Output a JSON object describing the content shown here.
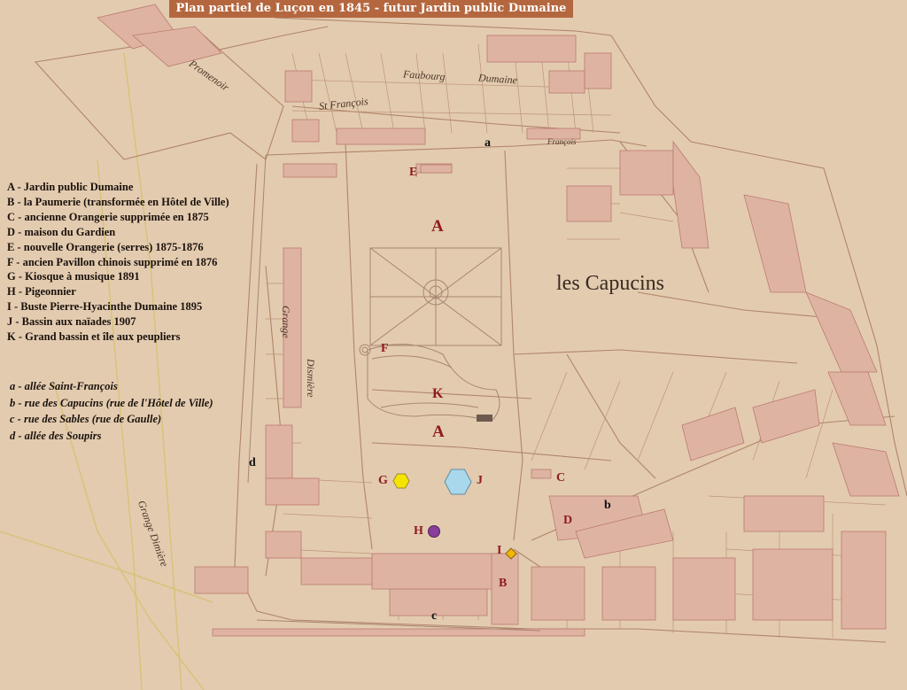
{
  "title": "Plan partiel de Luçon en 1845 - futur Jardin public Dumaine",
  "legend_uppercase": [
    "A - Jardin public Dumaine",
    "B - la Paumerie (transformée en Hôtel de Ville)",
    "C - ancienne Orangerie supprimée en 1875",
    "D - maison du Gardien",
    "E - nouvelle Orangerie (serres) 1875-1876",
    "F - ancien Pavillon chinois supprimé en 1876",
    "G - Kiosque à musique 1891",
    "H - Pigeonnier",
    "I - Buste Pierre-Hyacinthe Dumaine 1895",
    "J  - Bassin aux naïades 1907",
    "K - Grand bassin et île aux peupliers"
  ],
  "legend_lowercase": [
    "a - allée Saint-François",
    "b - rue des Capucins (rue de l'Hôtel de Ville)",
    "c - rue des Sables (rue de Gaulle)",
    "d - allée des Soupirs"
  ],
  "map_markers": {
    "A": "A",
    "B": "B",
    "C": "C",
    "D": "D",
    "E": "E",
    "F": "F",
    "G": "G",
    "H": "H",
    "I": "I",
    "J": "J",
    "K": "K",
    "a": "a",
    "b": "b",
    "c": "c",
    "d": "d"
  },
  "map_labels": {
    "capucins": "les Capucins",
    "faubourg": "Faubourg",
    "dumaine": "Dumaine",
    "st_francois": "St François",
    "promenoir": "Promenoir",
    "grange": "Grange",
    "dismiere": "Dismière",
    "grange_dimiere": "Grange Dimière",
    "francois": "François"
  },
  "symbol_colors": {
    "kiosque": "#f5e400",
    "bassin": "#a9d8ec",
    "pigeonnier": "#8a3d9a",
    "buste": "#f2b800",
    "letters": "#8f1b20",
    "parcel": "#dfb3a2"
  },
  "icons": {
    "G": "yellow-hexagon-icon",
    "J": "blue-hexagon-icon",
    "H": "purple-circle-icon",
    "I": "orange-diamond-icon"
  }
}
